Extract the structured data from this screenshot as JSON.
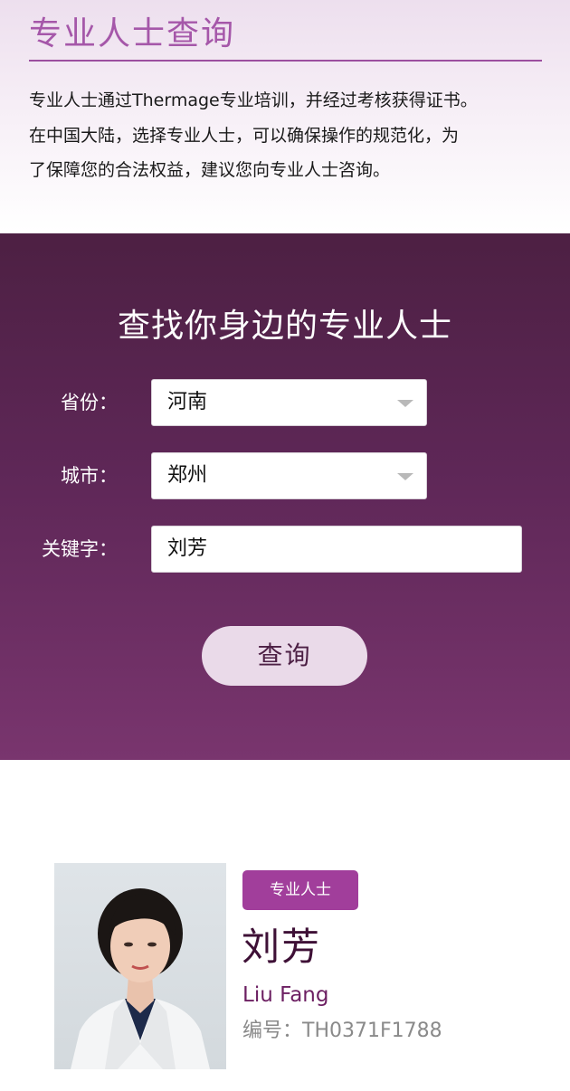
{
  "header": {
    "title": "专业人士查询",
    "description_lines": [
      "专业人士通过Thermage专业培训，并经过考核获得证书。",
      "在中国大陆，选择专业人士，可以确保操作的规范化，为",
      "了保障您的合法权益，建议您向专业人士咨询。"
    ]
  },
  "search": {
    "title": "查找你身边的专业人士",
    "province": {
      "label": "省份：",
      "value": "河南"
    },
    "city": {
      "label": "城市：",
      "value": "郑州"
    },
    "keyword": {
      "label": "关键字：",
      "value": "刘芳"
    },
    "submit_label": "查询"
  },
  "result": {
    "badge": "专业人士",
    "name_cn": "刘芳",
    "name_en": "Liu Fang",
    "cert_no": "编号：TH0371F1788"
  },
  "colors": {
    "accent": "#a557a9",
    "panel_dark": "#4d2043",
    "panel_light": "#79356e",
    "badge": "#a13e9b",
    "button_bg": "#eadae9"
  }
}
